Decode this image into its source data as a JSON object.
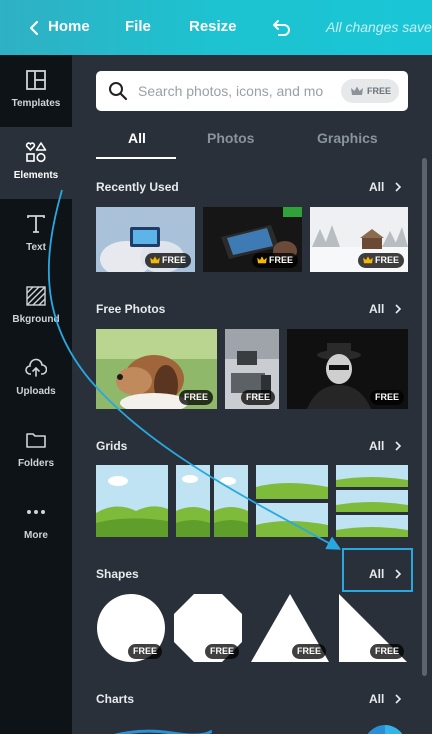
{
  "topbar": {
    "home_label": "Home",
    "file_label": "File",
    "resize_label": "Resize",
    "status_text": "All changes save"
  },
  "rail": {
    "items": [
      {
        "label": "Templates",
        "icon": "templates-icon"
      },
      {
        "label": "Elements",
        "icon": "elements-icon"
      },
      {
        "label": "Text",
        "icon": "text-icon"
      },
      {
        "label": "Bkground",
        "icon": "background-icon"
      },
      {
        "label": "Uploads",
        "icon": "uploads-icon"
      },
      {
        "label": "Folders",
        "icon": "folders-icon"
      },
      {
        "label": "More",
        "icon": "more-icon"
      }
    ],
    "active": "Elements"
  },
  "search": {
    "placeholder": "Search photos, icons, and mo",
    "free_label": "FREE"
  },
  "tabs": [
    "All",
    "Photos",
    "Graphics"
  ],
  "active_tab": "All",
  "sections": {
    "recently_used": {
      "title": "Recently Used",
      "all": "All"
    },
    "free_photos": {
      "title": "Free Photos",
      "all": "All"
    },
    "grids": {
      "title": "Grids",
      "all": "All"
    },
    "shapes": {
      "title": "Shapes",
      "all": "All"
    },
    "charts": {
      "title": "Charts",
      "all": "All"
    }
  },
  "badge_free": "FREE",
  "colors": {
    "topbar_start": "#2fb0c4",
    "topbar_end": "#1ac6d6",
    "panel_bg": "#293039",
    "rail_bg": "#0e1318",
    "annotation": "#29a8e0"
  }
}
